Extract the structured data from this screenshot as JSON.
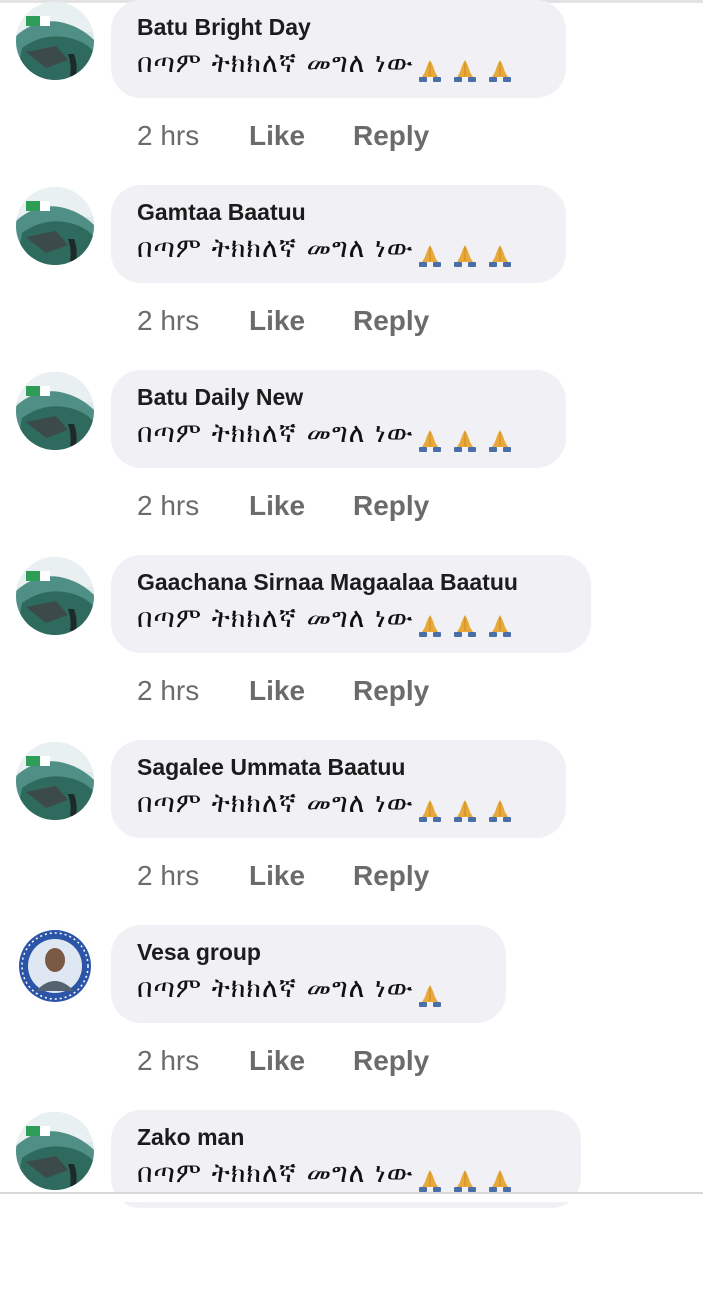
{
  "comments": [
    {
      "author": "Batu Bright Day",
      "text": "በጣም ትክክለኛ መግለ ነው",
      "reactions": 3,
      "time": "2 hrs",
      "like": "Like",
      "reply": "Reply",
      "avatar": "landscape-avatar"
    },
    {
      "author": "Gamtaa Baatuu",
      "text": "በጣም ትክክለኛ መግለ ነው",
      "reactions": 3,
      "time": "2 hrs",
      "like": "Like",
      "reply": "Reply",
      "avatar": "landscape-avatar"
    },
    {
      "author": "Batu Daily New",
      "text": "በጣም ትክክለኛ መግለ ነው",
      "reactions": 3,
      "time": "2 hrs",
      "like": "Like",
      "reply": "Reply",
      "avatar": "landscape-avatar"
    },
    {
      "author": "Gaachana Sirnaa Magaalaa Baatuu",
      "text": "በጣም ትክክለኛ መግለ ነው",
      "reactions": 3,
      "time": "2 hrs",
      "like": "Like",
      "reply": "Reply",
      "avatar": "landscape-avatar"
    },
    {
      "author": "Sagalee Ummata Baatuu",
      "text": "በጣም ትክክለኛ መግለ ነው",
      "reactions": 3,
      "time": "2 hrs",
      "like": "Like",
      "reply": "Reply",
      "avatar": "landscape-avatar"
    },
    {
      "author": "Vesa group",
      "text": "በጣም ትክክለኛ መግለ ነው",
      "reactions": 1,
      "time": "2 hrs",
      "like": "Like",
      "reply": "Reply",
      "avatar": "portrait-avatar"
    },
    {
      "author": "Zako man",
      "text": "በጣም ትክክለኛ መግለ ነው",
      "reactions": 3,
      "time": "",
      "like": "",
      "reply": "",
      "avatar": "landscape-avatar"
    }
  ],
  "emoji": "folded-hands-icon",
  "colors": {
    "bubble": "#f1f1f5",
    "meta": "#6b6b6b",
    "author": "#1c1c1c",
    "hand_skin": "#e8a93a",
    "hand_sleeve": "#4a6fa8"
  }
}
